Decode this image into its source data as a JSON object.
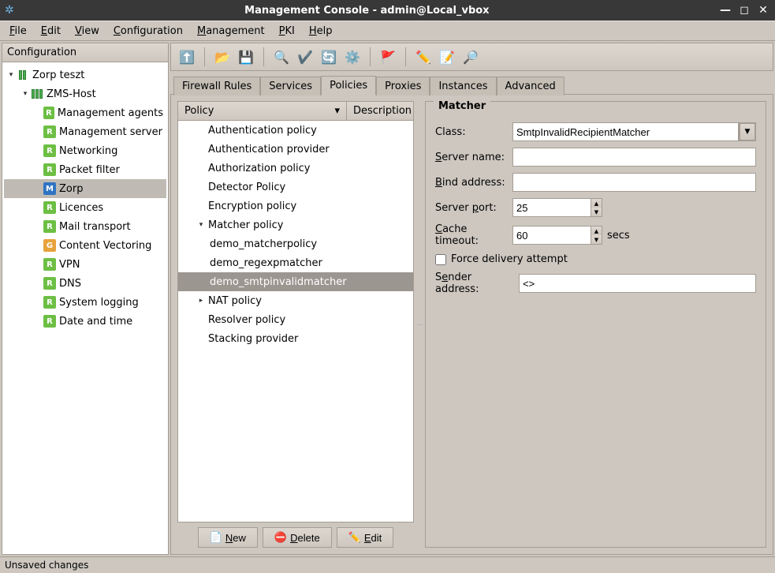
{
  "title": "Management Console - admin@Local_vbox",
  "menubar": [
    "File",
    "Edit",
    "View",
    "Configuration",
    "Management",
    "PKI",
    "Help"
  ],
  "sidebar": {
    "header": "Configuration",
    "root": "Zorp teszt",
    "host": "ZMS-Host",
    "items": [
      {
        "badge": "R",
        "label": "Management agents"
      },
      {
        "badge": "R",
        "label": "Management server"
      },
      {
        "badge": "R",
        "label": "Networking"
      },
      {
        "badge": "R",
        "label": "Packet filter"
      },
      {
        "badge": "M",
        "label": "Zorp",
        "selected": true
      },
      {
        "badge": "R",
        "label": "Licences"
      },
      {
        "badge": "R",
        "label": "Mail transport"
      },
      {
        "badge": "G",
        "label": "Content Vectoring"
      },
      {
        "badge": "R",
        "label": "VPN"
      },
      {
        "badge": "R",
        "label": "DNS"
      },
      {
        "badge": "R",
        "label": "System logging"
      },
      {
        "badge": "R",
        "label": "Date and time"
      }
    ]
  },
  "tabs": [
    "Firewall Rules",
    "Services",
    "Policies",
    "Proxies",
    "Instances",
    "Advanced"
  ],
  "active_tab": "Policies",
  "policy_table": {
    "cols": {
      "policy": "Policy",
      "description": "Description"
    },
    "rows": [
      {
        "label": "Authentication policy",
        "indent": 1
      },
      {
        "label": "Authentication provider",
        "indent": 1
      },
      {
        "label": "Authorization policy",
        "indent": 1
      },
      {
        "label": "Detector Policy",
        "indent": 1
      },
      {
        "label": "Encryption policy",
        "indent": 1
      },
      {
        "label": "Matcher policy",
        "indent": 1,
        "exp": "down"
      },
      {
        "label": "demo_matcherpolicy",
        "indent": 2
      },
      {
        "label": "demo_regexpmatcher",
        "indent": 2
      },
      {
        "label": "demo_smtpinvalidmatcher",
        "indent": 2,
        "selected": true
      },
      {
        "label": "NAT policy",
        "indent": 1,
        "exp": "right"
      },
      {
        "label": "Resolver policy",
        "indent": 1
      },
      {
        "label": "Stacking provider",
        "indent": 1
      }
    ]
  },
  "buttons": {
    "new": "New",
    "delete": "Delete",
    "edit": "Edit"
  },
  "matcher": {
    "title": "Matcher",
    "labels": {
      "class": "Class:",
      "server_name": "Server name:",
      "bind_address": "Bind address:",
      "server_port": "Server port:",
      "cache_timeout": "Cache timeout:",
      "secs": "secs",
      "force": "Force delivery attempt",
      "sender": "Sender address:"
    },
    "values": {
      "class": "SmtpInvalidRecipientMatcher",
      "server_name": "",
      "bind_address": "",
      "server_port": "25",
      "cache_timeout": "60",
      "force": false,
      "sender": "<>"
    }
  },
  "status": "Unsaved changes"
}
